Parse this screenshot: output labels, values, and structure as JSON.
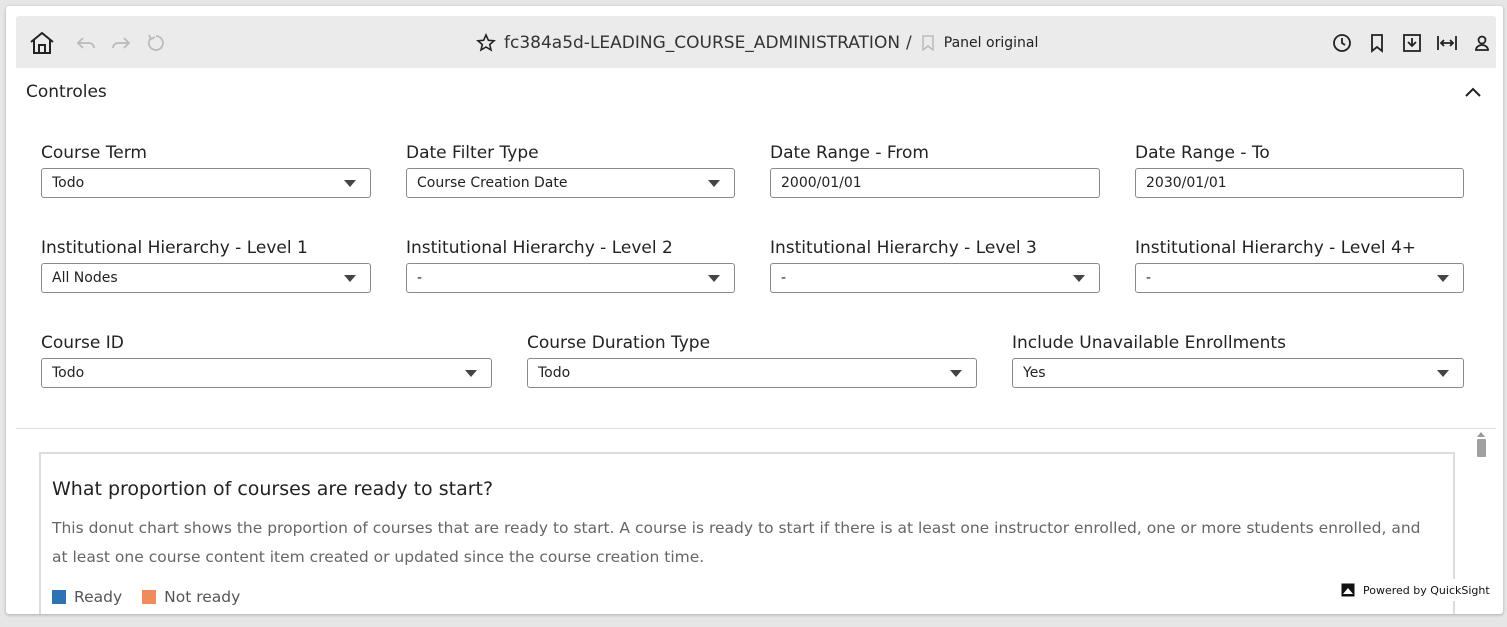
{
  "toolbar": {
    "dashboard_title": "fc384a5d-LEADING_COURSE_ADMINISTRATION",
    "separator": "/",
    "sheet_name": "Panel original",
    "icons": [
      "home-icon",
      "undo-icon",
      "redo-icon",
      "reset-icon",
      "star-icon",
      "bookmark-icon",
      "history-icon",
      "bookmarks-icon",
      "download-icon",
      "fit-width-icon",
      "user-icon"
    ]
  },
  "controls": {
    "title": "Controles",
    "row1": [
      {
        "label": "Course Term",
        "value": "Todo"
      },
      {
        "label": "Date Filter Type",
        "value": "Course Creation Date"
      },
      {
        "label": "Date Range - From",
        "value": "2000/01/01"
      },
      {
        "label": "Date Range - To",
        "value": "2030/01/01"
      }
    ],
    "row2": [
      {
        "label": "Institutional Hierarchy - Level 1",
        "value": "All Nodes"
      },
      {
        "label": "Institutional Hierarchy - Level 2",
        "value": "-"
      },
      {
        "label": "Institutional Hierarchy - Level 3",
        "value": "-"
      },
      {
        "label": "Institutional Hierarchy - Level 4+",
        "value": "-"
      }
    ],
    "row3": [
      {
        "label": "Course ID",
        "value": "Todo"
      },
      {
        "label": "Course Duration Type",
        "value": "Todo"
      },
      {
        "label": "Include Unavailable Enrollments",
        "value": "Yes"
      }
    ]
  },
  "visual": {
    "title": "What proportion of courses are ready to start?",
    "description": "This donut chart shows the proportion of courses that are ready to start. A course is ready to start if there is at least one instructor enrolled, one or more students enrolled, and at least one course content item created or updated since the course creation time.",
    "legend": [
      {
        "label": "Ready",
        "color": "#2e73b1"
      },
      {
        "label": "Not ready",
        "color": "#ef8c5e"
      }
    ]
  },
  "footer": {
    "powered_by": "Powered by QuickSight"
  }
}
